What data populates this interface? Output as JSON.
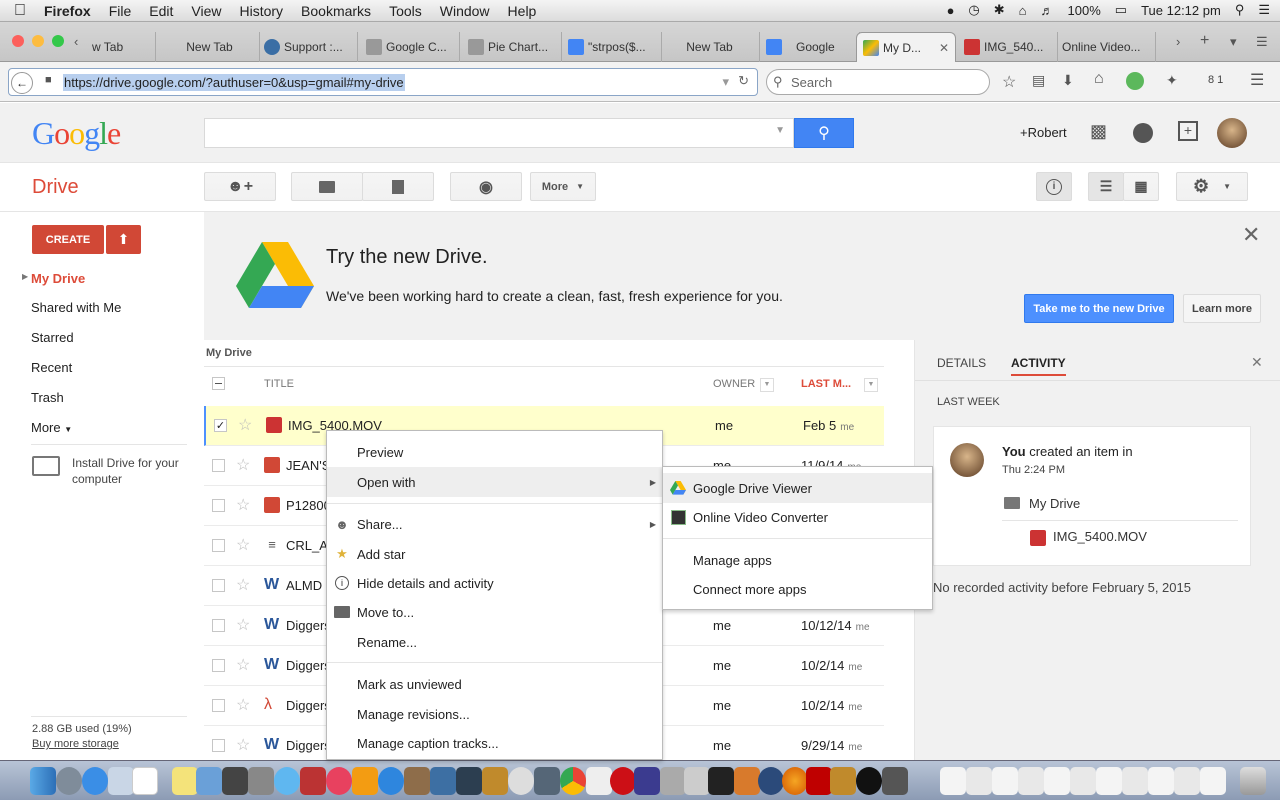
{
  "menubar": {
    "items": [
      "Firefox",
      "File",
      "Edit",
      "View",
      "History",
      "Bookmarks",
      "Tools",
      "Window",
      "Help"
    ],
    "battery": "100%",
    "clock": "Tue 12:12 pm"
  },
  "tabs": [
    {
      "label": "w Tab"
    },
    {
      "label": "New Tab"
    },
    {
      "label": "Support :..."
    },
    {
      "label": "Google C..."
    },
    {
      "label": "Pie Chart..."
    },
    {
      "label": "\"strpos($..."
    },
    {
      "label": "New Tab"
    },
    {
      "label": "Google"
    },
    {
      "label": "My D..."
    },
    {
      "label": "IMG_540..."
    },
    {
      "label": "Online Video..."
    }
  ],
  "navbar": {
    "url": "https://drive.google.com/?authuser=0&usp=gmail#my-drive",
    "search_placeholder": "Search",
    "badge": "8 1"
  },
  "google": {
    "logo": "Google",
    "user": "+Robert"
  },
  "drive": {
    "title": "Drive",
    "more_label": "More",
    "create_label": "CREATE"
  },
  "sidebar": {
    "items": [
      "My Drive",
      "Shared with Me",
      "Starred",
      "Recent",
      "Trash",
      "More"
    ],
    "install_label": "Install Drive for your computer",
    "storage": "2.88 GB used (19%)",
    "buy_storage": "Buy more storage"
  },
  "promo": {
    "title": "Try the new Drive.",
    "text": "We've been working hard to create a clean, fast, fresh experience for you.",
    "primary_button": "Take me to the new Drive",
    "secondary_button": "Learn more"
  },
  "filelist": {
    "breadcrumb": "My Drive",
    "col_title": "TITLE",
    "col_owner": "OWNER",
    "col_modified": "LAST M...",
    "rows": [
      {
        "name": "IMG_5400.MOV",
        "owner": "me",
        "date": "Feb 5",
        "by": "me",
        "icon": "video-icon",
        "selected": true
      },
      {
        "name": "JEAN'S",
        "owner": "me",
        "date": "11/9/14",
        "by": "me",
        "icon": "image-icon"
      },
      {
        "name": "P12800",
        "owner": "",
        "date": "",
        "by": "",
        "icon": "image-icon"
      },
      {
        "name": "CRL_A",
        "owner": "",
        "date": "",
        "by": "",
        "icon": "text-icon"
      },
      {
        "name": "ALMD",
        "owner": "",
        "date": "",
        "by": "",
        "icon": "word-icon"
      },
      {
        "name": "Diggers",
        "owner": "me",
        "date": "10/12/14",
        "by": "me",
        "icon": "word-icon"
      },
      {
        "name": "Diggers",
        "owner": "me",
        "date": "10/2/14",
        "by": "me",
        "icon": "word-icon"
      },
      {
        "name": "Diggers",
        "owner": "me",
        "date": "10/2/14",
        "by": "me",
        "icon": "pdf-icon"
      },
      {
        "name": "Diggers",
        "owner": "me",
        "date": "9/29/14",
        "by": "me",
        "icon": "word-icon"
      }
    ]
  },
  "details": {
    "tab_details": "DETAILS",
    "tab_activity": "ACTIVITY",
    "section": "LAST WEEK",
    "actor": "You",
    "action": "created an item in",
    "time": "Thu 2:24 PM",
    "folder": "My Drive",
    "file": "IMG_5400.MOV",
    "no_activity": "No recorded activity before February 5, 2015"
  },
  "context_menu": {
    "preview": "Preview",
    "open_with": "Open with",
    "share": "Share...",
    "add_star": "Add star",
    "hide_details": "Hide details and activity",
    "move_to": "Move to...",
    "rename": "Rename...",
    "mark_unviewed": "Mark as unviewed",
    "manage_revisions": "Manage revisions...",
    "manage_captions": "Manage caption tracks..."
  },
  "submenu": {
    "drive_viewer": "Google Drive Viewer",
    "video_converter": "Online Video Converter",
    "manage_apps": "Manage apps",
    "connect_apps": "Connect more apps"
  },
  "colors": {
    "drive_red": "#dd4b39",
    "create_red": "#d14836",
    "blue": "#4d90fe",
    "selected_row": "#ffffcc"
  }
}
